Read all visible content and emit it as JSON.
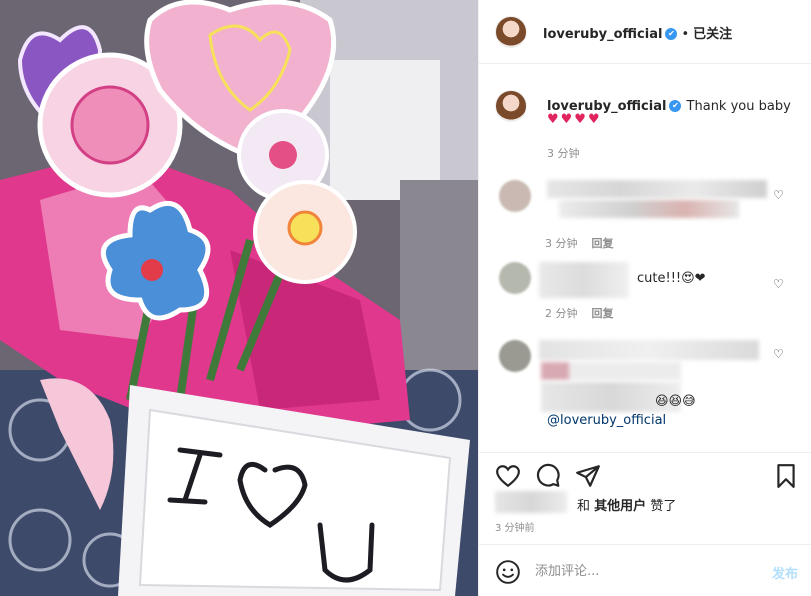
{
  "header": {
    "username": "loveruby_official",
    "verified_mark": "✔",
    "separator": "•",
    "follow_status": "已关注"
  },
  "caption": {
    "username": "loveruby_official",
    "verified_mark": "✔",
    "text": "Thank you baby",
    "hearts": "♥♥♥♥",
    "time": "3 分钟"
  },
  "comments": [
    {
      "text": "",
      "time": "3 分钟",
      "reply_label": "回复"
    },
    {
      "text": "cute!!!😍❤",
      "time": "2 分钟",
      "reply_label": "回复"
    },
    {
      "text": "😆😆😅",
      "mention": "@loveruby_official"
    }
  ],
  "actions": {
    "likes_connector": "和",
    "likes_others": "其他用户",
    "likes_suffix": "赞了",
    "time_ago": "3 分钟前"
  },
  "comment_box": {
    "placeholder": "添加评论...",
    "post_label": "发布"
  },
  "colors": {
    "verified": "#3897f0",
    "heart": "#e0245e",
    "post_disabled": "#b2dffc",
    "mention": "#00376b"
  },
  "icons": [
    "heart-icon",
    "comment-icon",
    "share-icon",
    "bookmark-icon",
    "smiley-icon",
    "like-heart-icon"
  ]
}
